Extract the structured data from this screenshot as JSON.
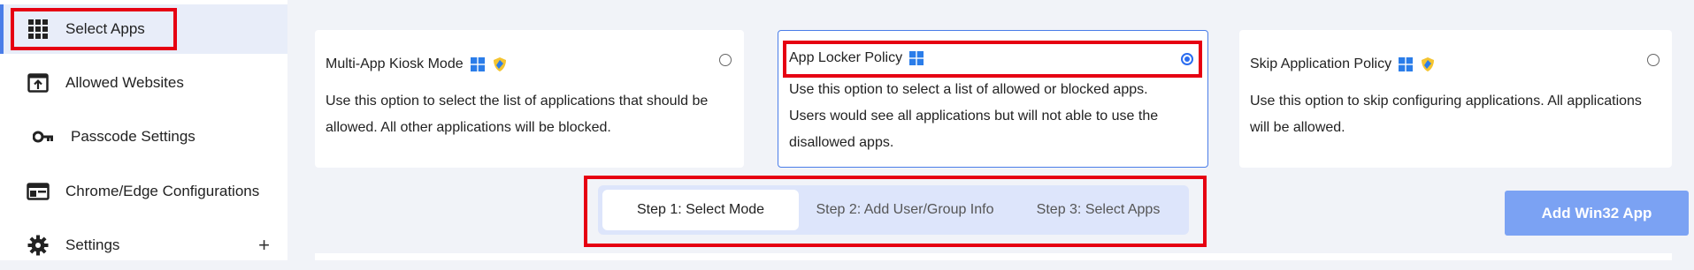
{
  "sidebar": {
    "items": [
      {
        "label": "Select Apps",
        "icon": "grid-icon"
      },
      {
        "label": "Allowed Websites",
        "icon": "upload-window-icon"
      },
      {
        "label": "Passcode Settings",
        "icon": "key-icon"
      },
      {
        "label": "Chrome/Edge Configurations",
        "icon": "browser-window-icon"
      },
      {
        "label": "Settings",
        "icon": "gear-icon",
        "expand": "+"
      }
    ]
  },
  "policies": [
    {
      "title": "Multi-App Kiosk Mode",
      "description": "Use this option to select the list of applications that should be allowed. All other applications will be blocked.",
      "selected": false
    },
    {
      "title": "App Locker Policy",
      "description": "Use this option to select a list of allowed or blocked apps. Users would see all applications but will not able to use the disallowed apps.",
      "selected": true
    },
    {
      "title": "Skip Application Policy",
      "description": "Use this option to skip configuring applications. All applications will be allowed.",
      "selected": false
    }
  ],
  "stepper": {
    "steps": [
      {
        "label": "Step 1: Select Mode",
        "active": true
      },
      {
        "label": "Step 2: Add User/Group Info",
        "active": false
      },
      {
        "label": "Step 3: Select Apps",
        "active": false
      }
    ]
  },
  "actions": {
    "add_win32_label": "Add Win32 App"
  },
  "colors": {
    "accent": "#4a7de8",
    "highlight_box": "#e60012",
    "button": "#7ba2f3",
    "windows_blue": "#2b7de9"
  }
}
